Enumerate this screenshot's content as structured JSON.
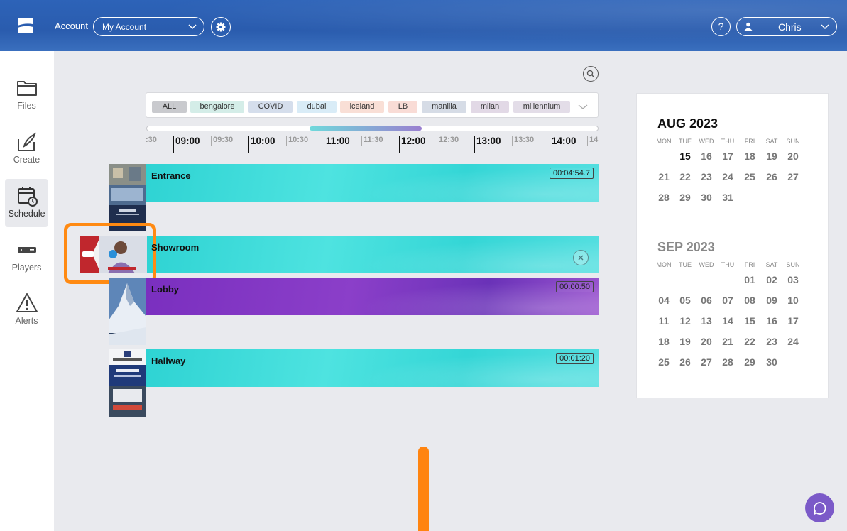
{
  "header": {
    "account_label": "Account",
    "account_value": "My Account",
    "help_label": "?",
    "user_name": "Chris"
  },
  "sidebar": {
    "items": [
      {
        "label": "Files",
        "icon": "folder-icon"
      },
      {
        "label": "Create",
        "icon": "create-icon"
      },
      {
        "label": "Schedule",
        "icon": "schedule-icon",
        "active": true
      },
      {
        "label": "Players",
        "icon": "player-icon"
      },
      {
        "label": "Alerts",
        "icon": "alert-icon"
      }
    ]
  },
  "filters": {
    "chips": [
      {
        "label": "ALL",
        "color": "#c9cace"
      },
      {
        "label": "bengalore",
        "color": "#d4ede8"
      },
      {
        "label": "COVID",
        "color": "#d5deec"
      },
      {
        "label": "dubai",
        "color": "#d9ecf7"
      },
      {
        "label": "iceland",
        "color": "#f9dfd6"
      },
      {
        "label": "LB",
        "color": "#f9dcd6"
      },
      {
        "label": "manilla",
        "color": "#d6dce6"
      },
      {
        "label": "milan",
        "color": "#e2d9e6"
      },
      {
        "label": "millennium",
        "color": "#e3dde8"
      }
    ]
  },
  "timeline": {
    "ticks": [
      ":30",
      "09:00",
      "09:30",
      "10:00",
      "10:30",
      "11:00",
      "11:30",
      "12:00",
      "12:30",
      "13:00",
      "13:30",
      "14:00",
      "14"
    ]
  },
  "players": [
    {
      "name": "Entrance",
      "duration": "00:04:54.7",
      "band": "cyan"
    },
    {
      "name": "Showroom",
      "duration": "",
      "band": "cyan"
    },
    {
      "name": "Lobby",
      "duration": "00:00:50",
      "band": "purple"
    },
    {
      "name": "Hallway",
      "duration": "00:01:20",
      "band": "cyan"
    }
  ],
  "calendar": {
    "dow": [
      "MON",
      "TUE",
      "WED",
      "THU",
      "FRI",
      "SAT",
      "SUN"
    ],
    "months": [
      {
        "title": "AUG 2023",
        "today": "15",
        "weeks": [
          [
            "",
            "15",
            "16",
            "17",
            "18",
            "19",
            "20"
          ],
          [
            "21",
            "22",
            "23",
            "24",
            "25",
            "26",
            "27"
          ],
          [
            "28",
            "29",
            "30",
            "31",
            "",
            "",
            ""
          ]
        ]
      },
      {
        "title": "SEP 2023",
        "weeks": [
          [
            "",
            "",
            "",
            "",
            "01",
            "02",
            "03"
          ],
          [
            "04",
            "05",
            "06",
            "07",
            "08",
            "09",
            "10"
          ],
          [
            "11",
            "12",
            "13",
            "14",
            "15",
            "16",
            "17"
          ],
          [
            "18",
            "19",
            "20",
            "21",
            "22",
            "23",
            "24"
          ],
          [
            "25",
            "26",
            "27",
            "28",
            "29",
            "30",
            ""
          ]
        ]
      }
    ]
  },
  "colors": {
    "header": "#2d63b8",
    "accent_orange": "#ff8a12",
    "chat": "#7b5ac8"
  }
}
